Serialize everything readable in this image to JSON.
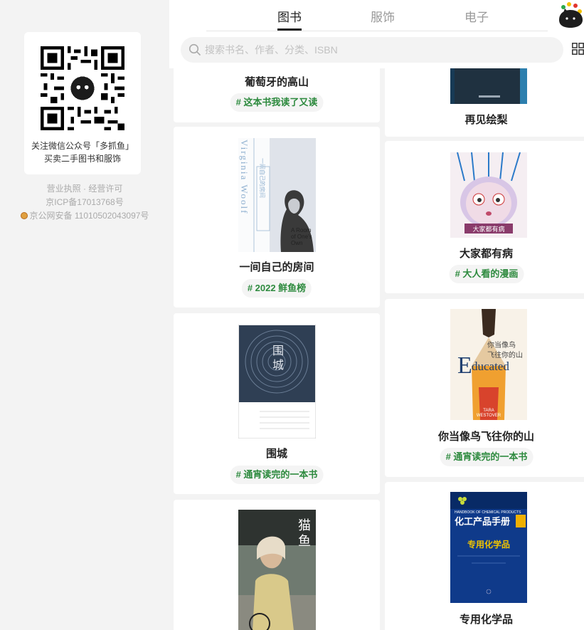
{
  "sidebar": {
    "qr_caption_line1": "关注微信公众号「多抓鱼」",
    "qr_caption_line2": "买卖二手图书和服饰",
    "legal_line1": "营业执照 · 经营许可",
    "legal_line2": "京ICP备17013768号",
    "legal_line3": "京公网安备 11010502043097号"
  },
  "tabs": [
    {
      "label": "图书",
      "active": true
    },
    {
      "label": "服饰",
      "active": false
    },
    {
      "label": "电子",
      "active": false
    }
  ],
  "search": {
    "placeholder": "搜索书名、作者、分类、ISBN",
    "value": ""
  },
  "icons": {
    "mascot": "mascot-cat-icon",
    "search": "search-icon",
    "grid": "grid-view-icon",
    "qr": "qr-code-icon",
    "police": "police-badge-icon"
  },
  "books": {
    "left": [
      {
        "title": "葡萄牙的高山",
        "tag": "# 这本书我读了又读"
      },
      {
        "title": "一间自己的房间",
        "tag": "# 2022 鲜鱼榜",
        "cover_text": {
          "author": "Virginia Woolf",
          "title_en": "A Room of One's Own",
          "title_cn": "一间自己的房间"
        }
      },
      {
        "title": "围城",
        "tag": "# 通宵读完的一本书",
        "cover_text": {
          "title_cn": "围城"
        }
      },
      {
        "title": "",
        "tag": "",
        "cover_text": {
          "title_cn": "猫鱼"
        }
      }
    ],
    "right": [
      {
        "title": "再见绘梨",
        "tag": ""
      },
      {
        "title": "大家都有病",
        "tag": "# 大人看的漫画",
        "cover_text": {
          "title_cn": "大家都有病"
        }
      },
      {
        "title": "你当像鸟飞往你的山",
        "tag": "# 通宵读完的一本书",
        "cover_text": {
          "title_cn": "你当像鸟飞往你的山",
          "title_en": "Educated",
          "author": "TARA WESTOVER"
        }
      },
      {
        "title": "专用化学品",
        "tag": "",
        "cover_text": {
          "series": "化工产品手册",
          "title_cn": "专用化学品",
          "series_en": "HANDBOOK OF CHEMICAL PRODUCTS"
        }
      }
    ]
  },
  "colors": {
    "tag_text": "#2d8a3e",
    "background": "#f3f3f3",
    "card": "#ffffff"
  }
}
